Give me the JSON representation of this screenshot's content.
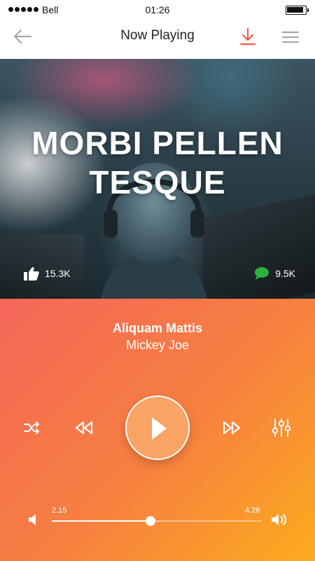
{
  "status": {
    "carrier": "Bell",
    "time": "01:26"
  },
  "header": {
    "title": "Now Playing"
  },
  "hero": {
    "title": "MORBI PELLEN TESQUE",
    "likes": "15.3K",
    "comments": "9.5K"
  },
  "track": {
    "artist": "Aliquam Mattis",
    "song": "Mickey Joe",
    "elapsed": "2.15",
    "total": "4.28",
    "progress": 0.47
  },
  "colors": {
    "accent": "#f15a4a",
    "gradient_start": "#f5665a",
    "gradient_end": "#fcab1e",
    "comment": "#2ab23d"
  },
  "icons": [
    "back-arrow-icon",
    "download-icon",
    "menu-icon",
    "thumbs-up-icon",
    "comment-icon",
    "shuffle-icon",
    "rewind-icon",
    "play-icon",
    "fast-forward-icon",
    "equalizer-icon",
    "volume-low-icon",
    "volume-high-icon"
  ]
}
